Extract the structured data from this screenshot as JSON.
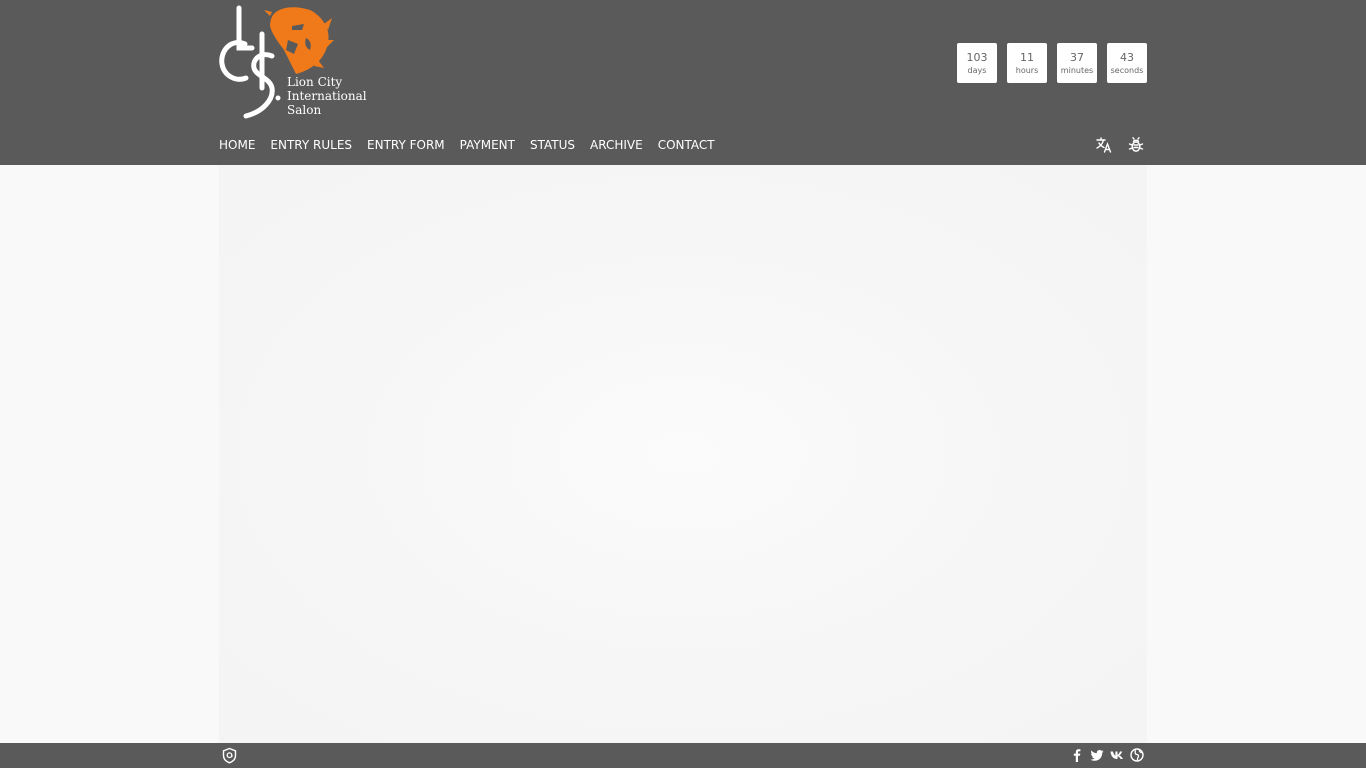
{
  "brand": {
    "name_lines": [
      "Lion City",
      "International",
      "Salon"
    ],
    "monogram": "LCIS",
    "accent_color": "#f07a1a"
  },
  "countdown": [
    {
      "value": "103",
      "unit": "days"
    },
    {
      "value": "11",
      "unit": "hours"
    },
    {
      "value": "37",
      "unit": "minutes"
    },
    {
      "value": "43",
      "unit": "seconds"
    }
  ],
  "nav": {
    "items": [
      {
        "label": "HOME"
      },
      {
        "label": "ENTRY RULES"
      },
      {
        "label": "ENTRY FORM"
      },
      {
        "label": "PAYMENT"
      },
      {
        "label": "STATUS"
      },
      {
        "label": "ARCHIVE"
      },
      {
        "label": "CONTACT"
      }
    ]
  },
  "header_icons": [
    "translate-icon",
    "bug-icon"
  ],
  "footer": {
    "left_icon": "privacy-shield-icon",
    "social_icons": [
      "facebook-icon",
      "twitter-icon",
      "vk-icon",
      "globe-icon"
    ]
  },
  "colors": {
    "header_bg": "#5a5a5a",
    "page_bg": "#f9f9f9"
  }
}
